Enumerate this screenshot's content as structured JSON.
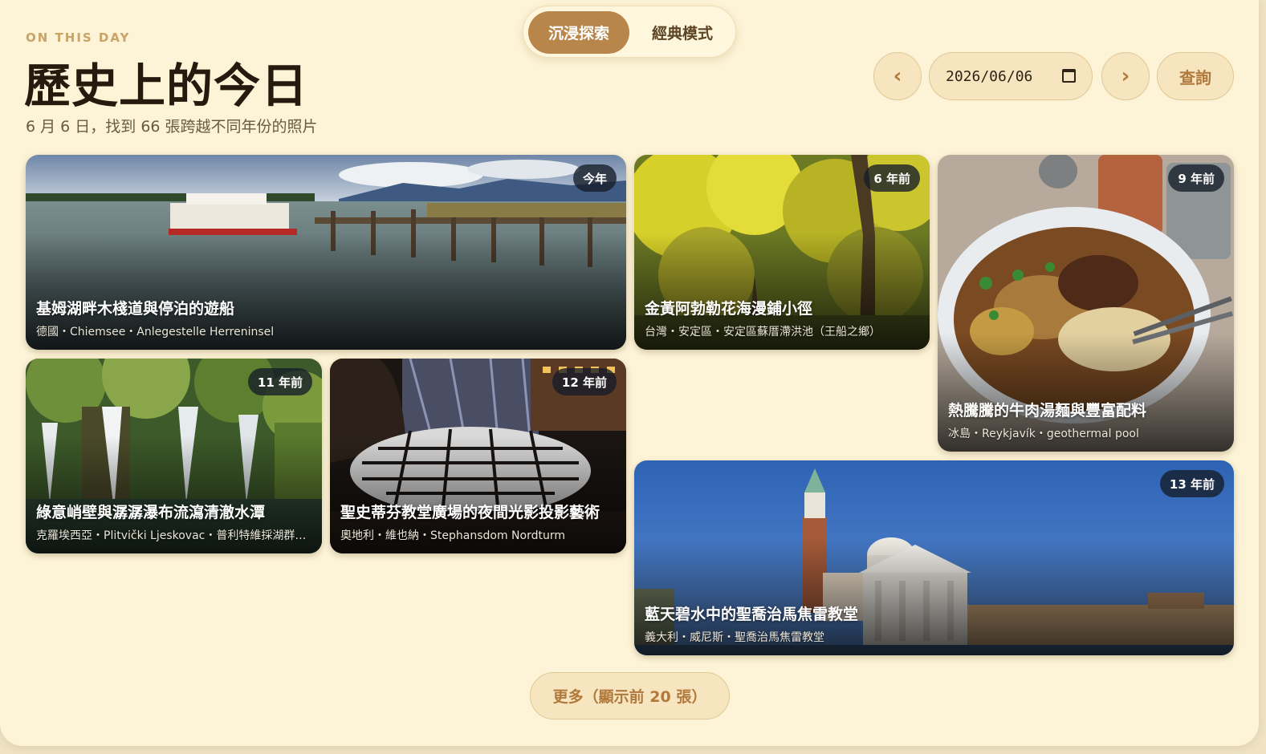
{
  "mode_toggle": {
    "immersive_label": "沉浸探索",
    "classic_label": "經典模式",
    "active": "immersive"
  },
  "header": {
    "eyebrow": "ON THIS DAY",
    "title": "歷史上的今日",
    "subtitle": "6 月 6 日，找到 66 張跨越不同年份的照片"
  },
  "controls": {
    "prev_label": "‹",
    "next_label": "›",
    "date_value": "2026/06/06",
    "query_label": "查詢"
  },
  "cards": [
    {
      "badge": "今年",
      "title": "基姆湖畔木棧道與停泊的遊船",
      "location": "德國・Chiemsee・Anlegestelle Herreninsel"
    },
    {
      "badge": "6 年前",
      "title": "金黃阿勃勒花海漫鋪小徑",
      "location": "台灣・安定區・安定區蘇厝滯洪池（王船之鄉）"
    },
    {
      "badge": "9 年前",
      "title": "熱騰騰的牛肉湯麵與豐富配料",
      "location": "冰島・Reykjavík・geothermal pool"
    },
    {
      "badge": "11 年前",
      "title": "綠意峭壁與潺潺瀑布流瀉清澈水潭",
      "location": "克羅埃西亞・Plitvički Ljeskovac・普利特維採湖群國家公園"
    },
    {
      "badge": "12 年前",
      "title": "聖史蒂芬教堂廣場的夜間光影投影藝術",
      "location": "奧地利・維也納・Stephansdom Nordturm"
    },
    {
      "badge": "13 年前",
      "title": "藍天碧水中的聖喬治馬焦雷教堂",
      "location": "義大利・威尼斯・聖喬治馬焦雷教堂"
    }
  ],
  "more_button": {
    "label": "更多（顯示前 20 張）"
  },
  "colors": {
    "background": "#fdf3d6",
    "accent": "#b8864b",
    "button_bg": "#f7e5c0",
    "button_text": "#b07a3c",
    "badge_bg": "#141c28"
  }
}
